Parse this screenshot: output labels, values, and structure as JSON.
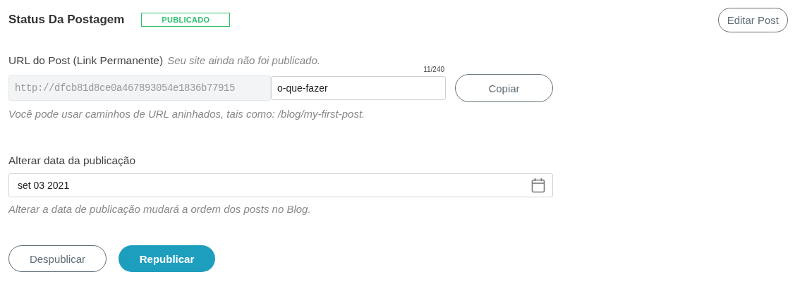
{
  "header": {
    "title": "Status Da Postagem",
    "status_badge": "PUBLICADO",
    "edit_button": "Editar Post"
  },
  "url": {
    "label": "URL do Post (Link Permanente)",
    "note": "Seu site ainda não foi publicado.",
    "counter": "11/240",
    "prefix": "http://dfcb81d8ce0a467893054e1836b77915",
    "slug": "o-que-fazer",
    "copy_button": "Copiar",
    "hint": "Você pode usar caminhos de URL aninhados, tais como: /blog/my-first-post."
  },
  "date": {
    "label": "Alterar data da publicação",
    "value": "set 03 2021",
    "hint": "Alterar a data de publicação mudará a ordem dos posts no Blog."
  },
  "buttons": [
    {
      "label": "Despublicar",
      "kind": "outline"
    },
    {
      "label": "Republicar",
      "kind": "primary"
    }
  ]
}
